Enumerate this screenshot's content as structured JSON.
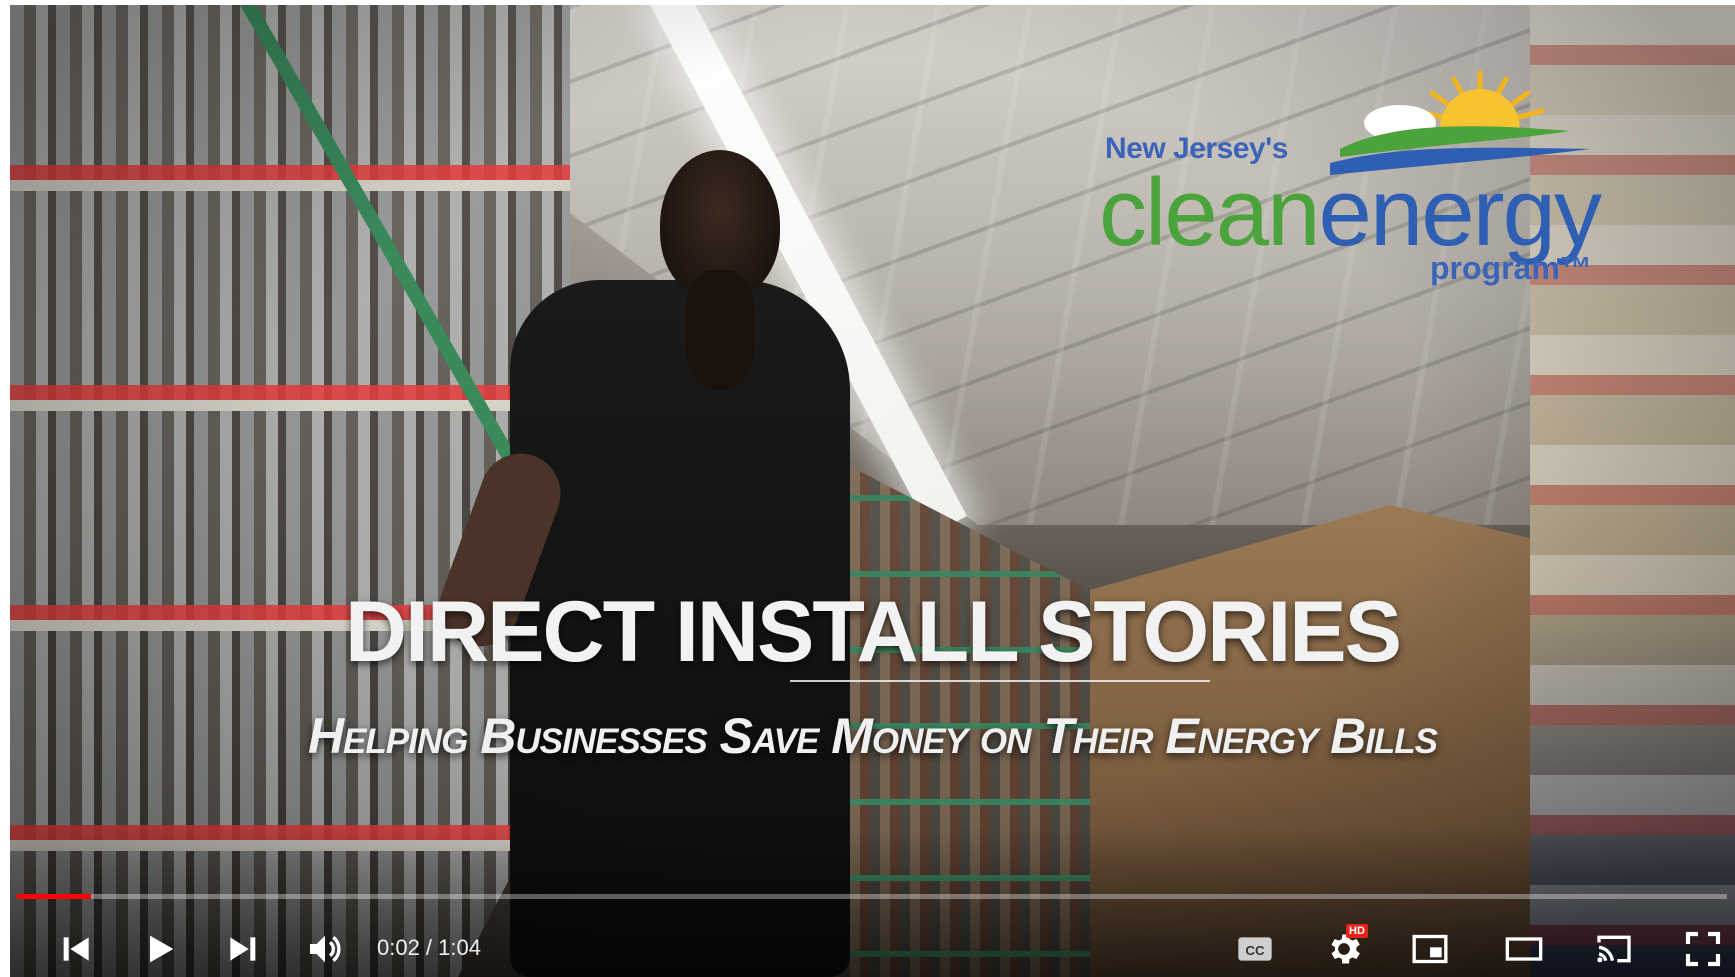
{
  "logo": {
    "tagline": "New Jersey's",
    "wordmark_clean": "clean",
    "wordmark_energy": "energy",
    "program": "program™"
  },
  "video": {
    "title": "DIRECT INSTALL STORIES",
    "subtitle": "Helping Businesses Save Money on Their Energy Bills"
  },
  "player": {
    "current_time": "0:02",
    "duration": "1:04",
    "time_display": "0:02 / 1:04",
    "progress_fraction": 0.043,
    "hd_badge": "HD",
    "accent_color": "#ff0000"
  },
  "icons": {
    "previous": "previous-icon",
    "play": "play-icon",
    "next": "next-icon",
    "volume": "volume-icon",
    "captions": "captions-icon",
    "settings": "gear-icon",
    "miniplayer": "miniplayer-icon",
    "theater": "theater-mode-icon",
    "cast": "cast-icon",
    "fullscreen": "fullscreen-icon"
  }
}
